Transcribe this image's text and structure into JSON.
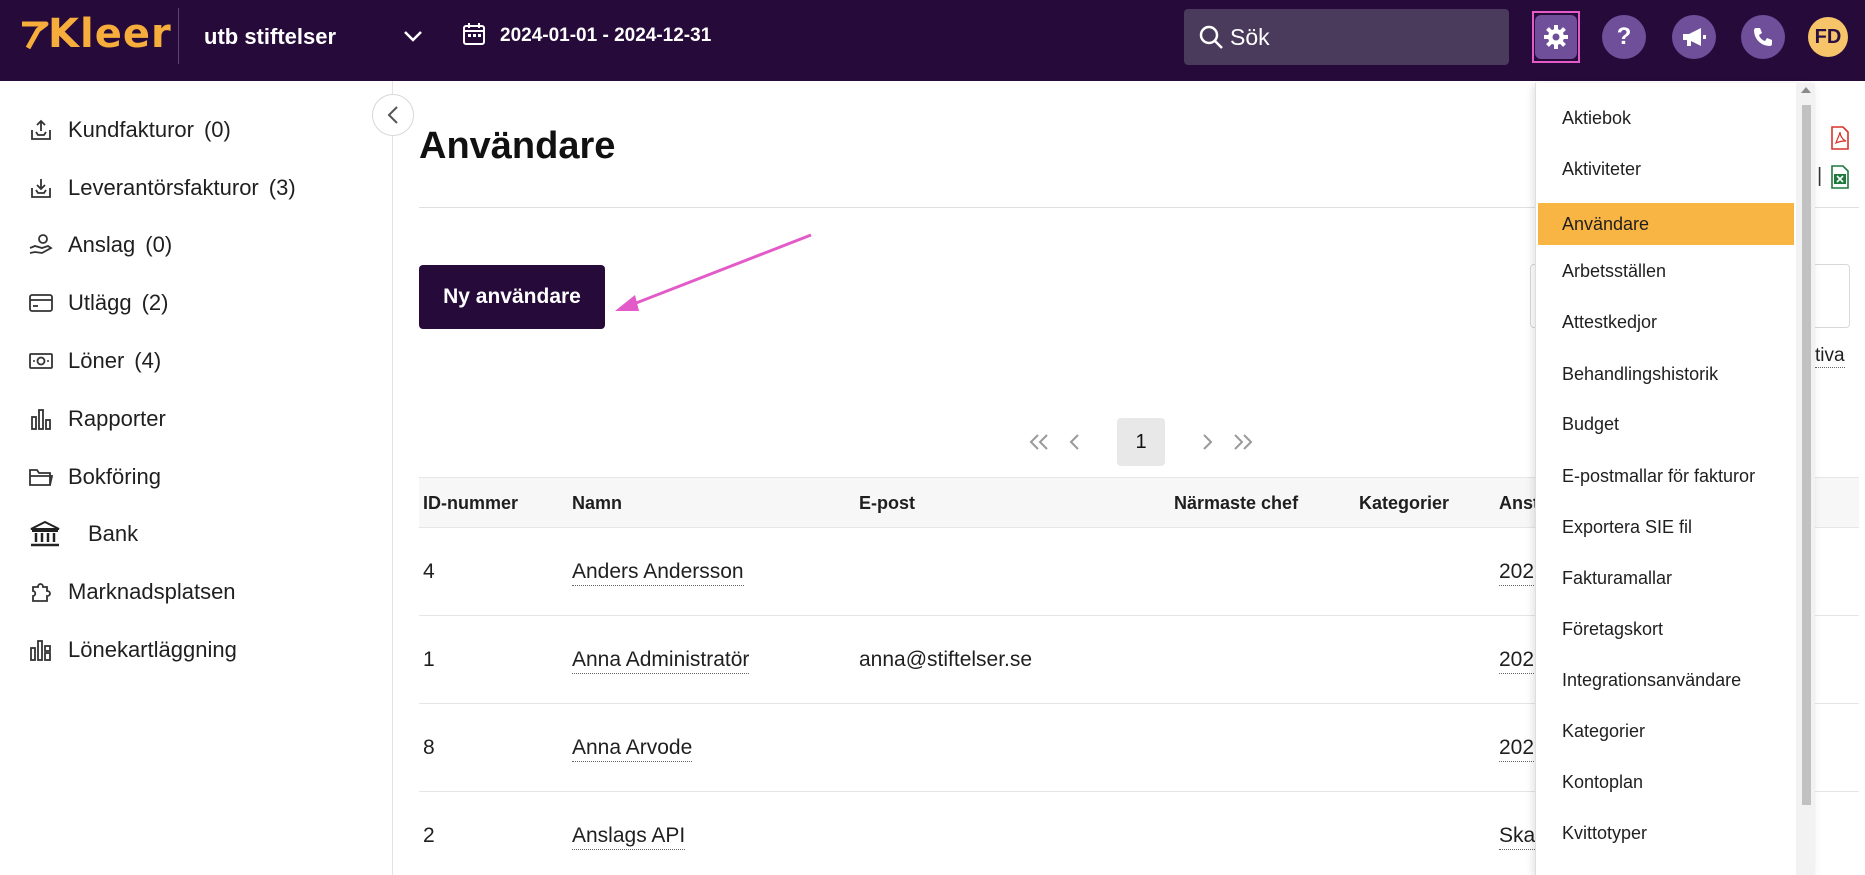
{
  "header": {
    "logo_text": "Kleer",
    "company": "utb stiftelser",
    "date_range": "2024-01-01 - 2024-12-31",
    "search_placeholder": "Sök",
    "help_label": "?",
    "avatar_initials": "FD"
  },
  "sidebar": {
    "items": [
      {
        "label": "Kundfakturor",
        "count": "(0)",
        "icon": "invoice-out-icon"
      },
      {
        "label": "Leverantörsfakturor",
        "count": "(3)",
        "icon": "invoice-in-icon"
      },
      {
        "label": "Anslag",
        "count": "(0)",
        "icon": "grant-hand-icon"
      },
      {
        "label": "Utlägg",
        "count": "(2)",
        "icon": "card-icon"
      },
      {
        "label": "Löner",
        "count": "(4)",
        "icon": "money-icon"
      },
      {
        "label": "Rapporter",
        "count": "",
        "icon": "bar-chart-icon"
      },
      {
        "label": "Bokföring",
        "count": "",
        "icon": "folder-icon"
      },
      {
        "label": "Bank",
        "count": "",
        "icon": "bank-icon"
      },
      {
        "label": "Marknadsplatsen",
        "count": "",
        "icon": "puzzle-icon"
      },
      {
        "label": "Lönekartläggning",
        "count": "",
        "icon": "salary-chart-icon"
      }
    ]
  },
  "main": {
    "title": "Användare",
    "new_user_button": "Ny användare",
    "pagination": {
      "current": "1"
    },
    "table": {
      "columns": [
        "ID-nummer",
        "Namn",
        "E-post",
        "Närmaste chef",
        "Kategorier",
        "Anst"
      ],
      "rows": [
        {
          "id": "4",
          "name": "Anders Andersson",
          "email": "",
          "extra": "202"
        },
        {
          "id": "1",
          "name": "Anna Administratör",
          "email": "anna@stiftelser.se",
          "extra": "202"
        },
        {
          "id": "8",
          "name": "Anna Arvode",
          "email": "",
          "extra": "202"
        },
        {
          "id": "2",
          "name": "Anslags API",
          "email": "",
          "extra": "Ska"
        }
      ]
    },
    "right_partial": {
      "pipe": "|",
      "link": "tiva"
    }
  },
  "settings_menu": {
    "items": [
      "Aktiebok",
      "Aktiviteter",
      "Användare",
      "Arbetsställen",
      "Attestkedjor",
      "Behandlingshistorik",
      "Budget",
      "E-postmallar för fakturor",
      "Exportera SIE fil",
      "Fakturamallar",
      "Företagskort",
      "Integrationsanvändare",
      "Kategorier",
      "Kontoplan",
      "Kvittotyper"
    ],
    "active_index": 2
  },
  "colors": {
    "topbar_bg": "#260a3a",
    "accent_orange": "#f8b544",
    "highlight_pink": "#e35bc8",
    "button_dark": "#260a3a"
  }
}
